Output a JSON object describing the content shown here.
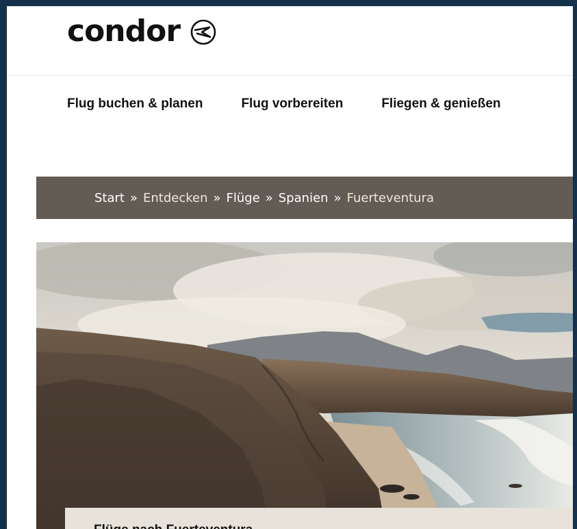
{
  "header": {
    "logo_text": "condor",
    "logo_mark_icon": "condor-bird-circle-icon"
  },
  "nav": {
    "items": [
      {
        "label": "Flug buchen & planen"
      },
      {
        "label": "Flug vorbereiten"
      },
      {
        "label": "Fliegen & genießen"
      }
    ]
  },
  "breadcrumb": {
    "separator": "»",
    "items": [
      {
        "label": "Start"
      },
      {
        "label": "Entdecken"
      },
      {
        "label": "Flüge"
      },
      {
        "label": "Spanien"
      },
      {
        "label": "Fuerteventura"
      }
    ]
  },
  "hero": {
    "image_icon": "coastal-cliffs-beach-photo"
  },
  "caption": {
    "title": "Flüge nach Fuerteventura"
  },
  "colors": {
    "page_background": "#14304a",
    "breadcrumb_bar": "#635c55",
    "caption_card": "#e7e2da",
    "text_dark": "#111111"
  }
}
